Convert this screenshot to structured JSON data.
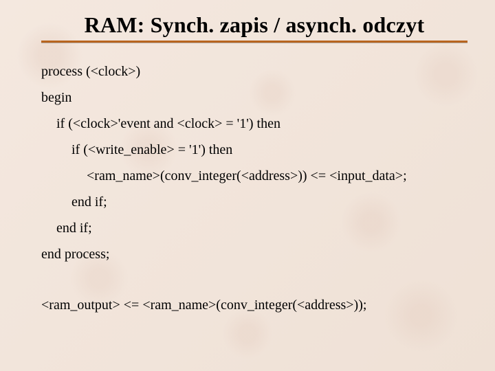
{
  "title": "RAM: Synch. zapis / asynch. odczyt",
  "code": {
    "l1": "process (<clock>)",
    "l2": "begin",
    "l3": "if (<clock>'event and <clock> = '1') then",
    "l4": "if (<write_enable> = '1') then",
    "l5": "<ram_name>(conv_integer(<address>)) <= <input_data>;",
    "l6": "end if;",
    "l7": "end if;",
    "l8": "end process;",
    "l9": "<ram_output> <= <ram_name>(conv_integer(<address>));"
  }
}
